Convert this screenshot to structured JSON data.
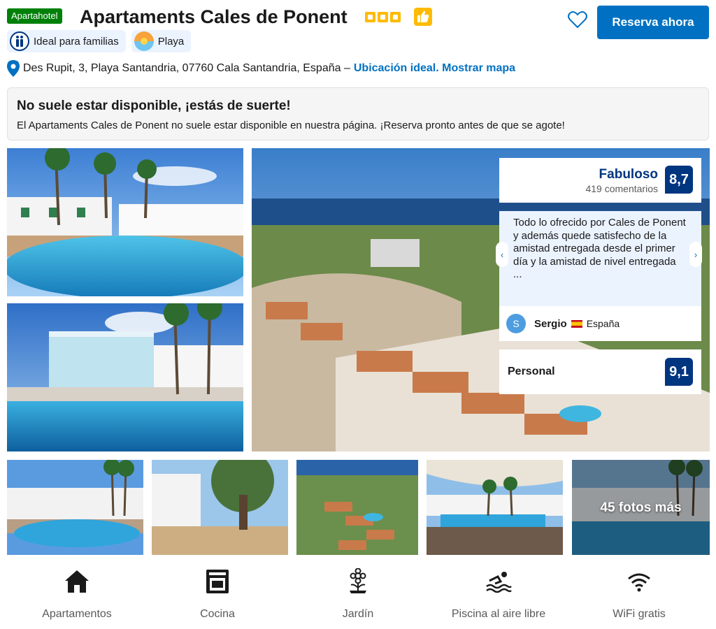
{
  "header": {
    "type_badge": "Apartahotel",
    "hotel_name": "Apartaments Cales de Ponent",
    "star_count": 3,
    "reserve_label": "Reserva ahora"
  },
  "tags": [
    {
      "label": "Ideal para familias",
      "icon": "family-icon"
    },
    {
      "label": "Playa",
      "icon": "beach-icon"
    }
  ],
  "address": {
    "text": "Des Rupit, 3, Playa Santandria, 07760 Cala Santandria, España –",
    "link": "Ubicación ideal. Mostrar mapa"
  },
  "alert": {
    "title": "No suele estar disponible, ¡estás de suerte!",
    "text": "El Apartaments Cales de Ponent no suele estar disponible en nuestra página. ¡Reserva pronto antes de que se agote!"
  },
  "review": {
    "score_word": "Fabuloso",
    "review_count": "419 comentarios",
    "score": "8,7",
    "text": "Todo lo ofrecido por Cales de Ponent y además quede satisfecho de la amistad entregada desde el primer día y la amistad de nivel entregada ...",
    "reviewer_initial": "S",
    "reviewer_name": "Sergio",
    "reviewer_country": "España",
    "staff_label": "Personal",
    "staff_score": "9,1"
  },
  "gallery": {
    "more_photos": "45 fotos más"
  },
  "facilities": [
    {
      "label": "Apartamentos",
      "icon": "home-icon"
    },
    {
      "label": "Cocina",
      "icon": "oven-icon"
    },
    {
      "label": "Jardín",
      "icon": "flower-icon"
    },
    {
      "label": "Piscina al aire libre",
      "icon": "swimming-icon"
    },
    {
      "label": "WiFi gratis",
      "icon": "wifi-icon"
    }
  ],
  "colors": {
    "brand_blue": "#0071c2",
    "score_navy": "#003580",
    "badge_green": "#008009",
    "star_yellow": "#febb02"
  }
}
